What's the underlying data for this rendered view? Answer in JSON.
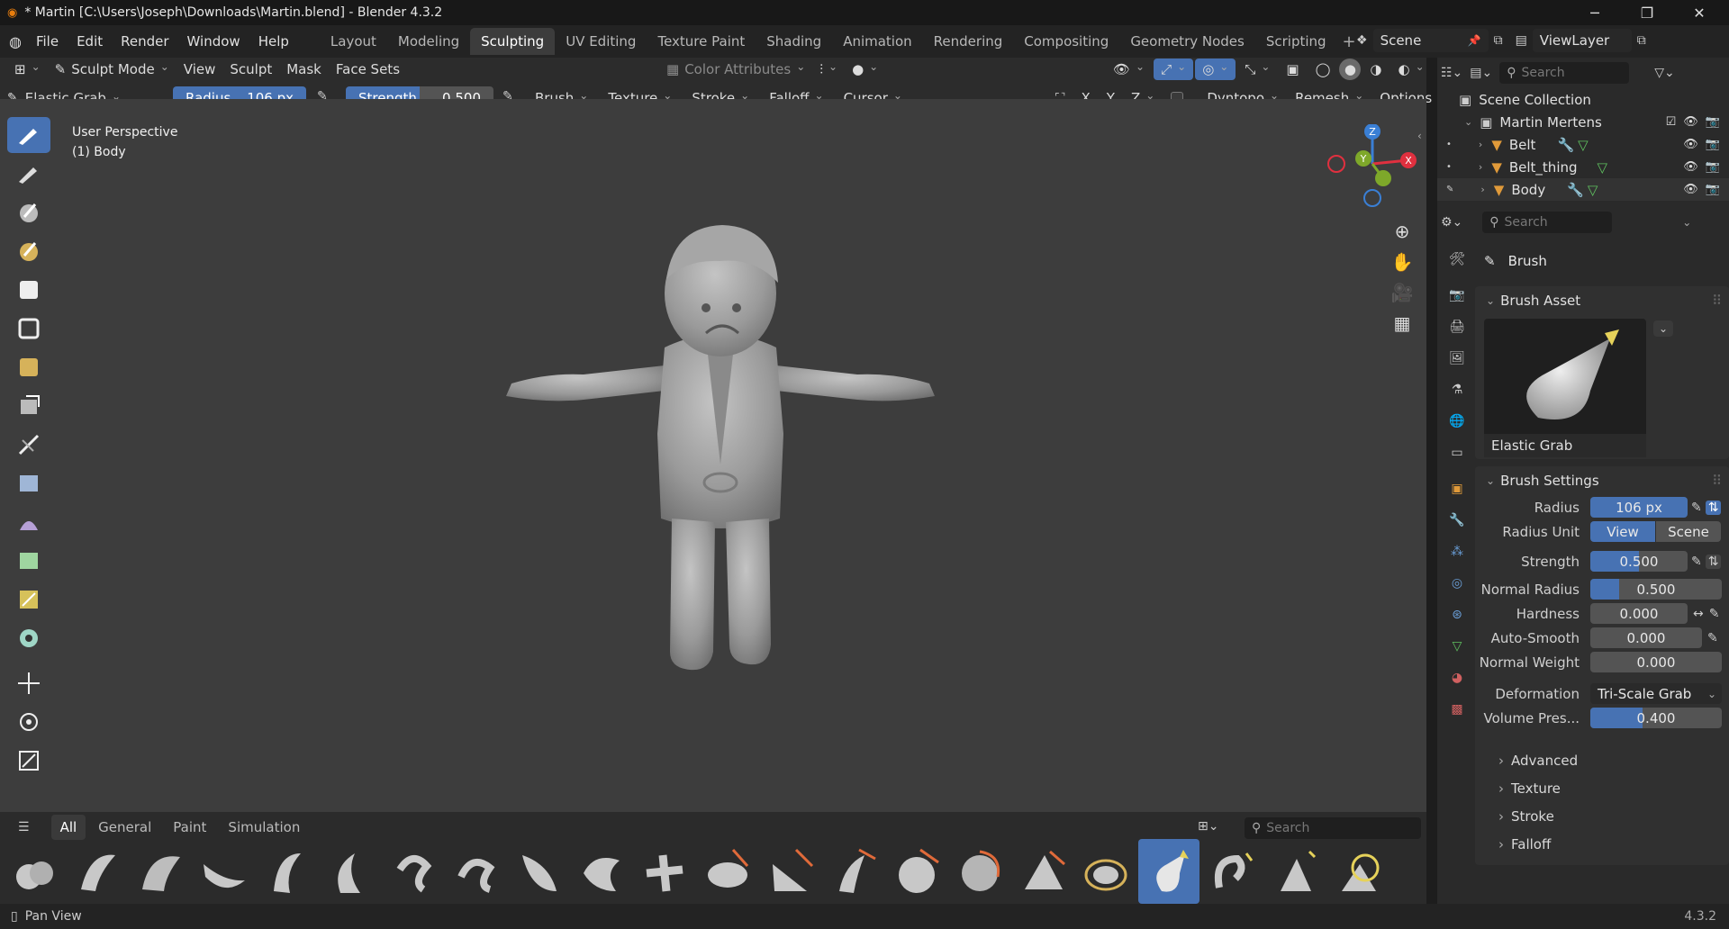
{
  "titlebar": {
    "title": "* Martin [C:\\Users\\Joseph\\Downloads\\Martin.blend] - Blender 4.3.2"
  },
  "menu": {
    "items": [
      "File",
      "Edit",
      "Render",
      "Window",
      "Help"
    ]
  },
  "workspaces": {
    "tabs": [
      "Layout",
      "Modeling",
      "Sculpting",
      "UV Editing",
      "Texture Paint",
      "Shading",
      "Animation",
      "Rendering",
      "Compositing",
      "Geometry Nodes",
      "Scripting"
    ],
    "active": "Sculpting"
  },
  "scene": {
    "name": "Scene",
    "view_layer": "ViewLayer"
  },
  "header": {
    "mode": "Sculpt Mode",
    "view": "View",
    "sculpt": "Sculpt",
    "mask": "Mask",
    "face_sets": "Face Sets",
    "color_attributes": "Color Attributes",
    "brush_name": "Elastic Grab",
    "radius_label": "Radius",
    "radius_value": "106 px",
    "strength_label": "Strength",
    "strength_value": "0.500",
    "brush": "Brush",
    "texture": "Texture",
    "stroke": "Stroke",
    "falloff": "Falloff",
    "cursor": "Cursor",
    "x": "X",
    "y": "Y",
    "z": "Z",
    "dyntopo": "Dyntopo",
    "remesh": "Remesh",
    "options": "Options"
  },
  "viewport": {
    "perspective": "User Perspective",
    "object": "(1) Body"
  },
  "gizmo": {
    "x": "X",
    "y": "Y",
    "z": "Z"
  },
  "assetbar": {
    "tabs": [
      "All",
      "General",
      "Paint",
      "Simulation"
    ],
    "active_tab": "All",
    "search_placeholder": "Search"
  },
  "statusbar": {
    "hint": "Pan View",
    "version": "4.3.2"
  },
  "outliner": {
    "search_placeholder": "Search",
    "root": "Scene Collection",
    "collection": "Martin Mertens",
    "items": [
      "Belt",
      "Belt_thing",
      "Body"
    ]
  },
  "properties": {
    "search_placeholder": "Search",
    "context": "Brush",
    "brush_asset_title": "Brush Asset",
    "brush_asset_name": "Elastic Grab",
    "brush_settings_title": "Brush Settings",
    "radius": {
      "label": "Radius",
      "value": "106 px"
    },
    "radius_unit": {
      "label": "Radius Unit",
      "options": [
        "View",
        "Scene"
      ],
      "selected": "View"
    },
    "strength": {
      "label": "Strength",
      "value": "0.500",
      "fraction": 0.5
    },
    "normal_radius": {
      "label": "Normal Radius",
      "value": "0.500",
      "fraction": 0.5
    },
    "hardness": {
      "label": "Hardness",
      "value": "0.000"
    },
    "auto_smooth": {
      "label": "Auto-Smooth",
      "value": "0.000"
    },
    "normal_weight": {
      "label": "Normal Weight",
      "value": "0.000"
    },
    "deformation": {
      "label": "Deformation",
      "value": "Tri-Scale Grab"
    },
    "volume_preservation": {
      "label": "Volume Pres...",
      "value": "0.400",
      "fraction": 0.4
    },
    "subpanels": [
      "Advanced",
      "Texture",
      "Stroke",
      "Falloff"
    ]
  },
  "colors": {
    "accent": "#4772b3",
    "x_axis": "#e0303f",
    "y_axis": "#7ea82a",
    "z_axis": "#3a7fd5"
  }
}
